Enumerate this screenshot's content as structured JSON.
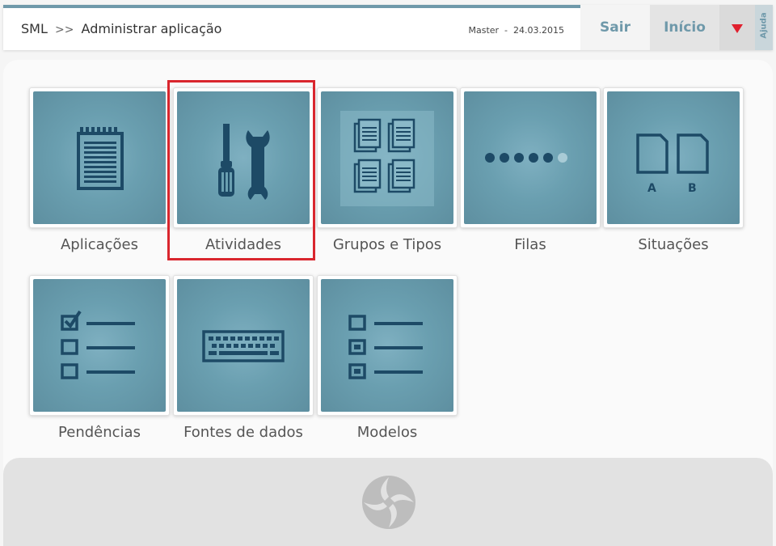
{
  "header": {
    "breadcrumb_root": "SML",
    "breadcrumb_sep": ">>",
    "breadcrumb_page": "Administrar aplicação",
    "meta": "Master  -  24.03.2015",
    "sair_label": "Sair",
    "inicio_label": "Início",
    "ajuda_label": "Ajuda"
  },
  "tiles": [
    {
      "label": "Aplicações",
      "icon": "notepad-icon"
    },
    {
      "label": "Atividades",
      "icon": "tools-icon"
    },
    {
      "label": "Grupos e Tipos",
      "icon": "document-stacks-icon"
    },
    {
      "label": "Filas",
      "icon": "dots-icon"
    },
    {
      "label": "Situações",
      "icon": "documents-ab-icon"
    },
    {
      "label": "Pendências",
      "icon": "checklist-icon"
    },
    {
      "label": "Fontes de dados",
      "icon": "keyboard-icon"
    },
    {
      "label": "Modelos",
      "icon": "form-list-icon"
    }
  ],
  "colors": {
    "accent": "#6f99aa",
    "tile": "#6a9fb0",
    "icon": "#1d4a66",
    "highlight": "#d9262e",
    "dropdown_arrow": "#e0202e"
  }
}
